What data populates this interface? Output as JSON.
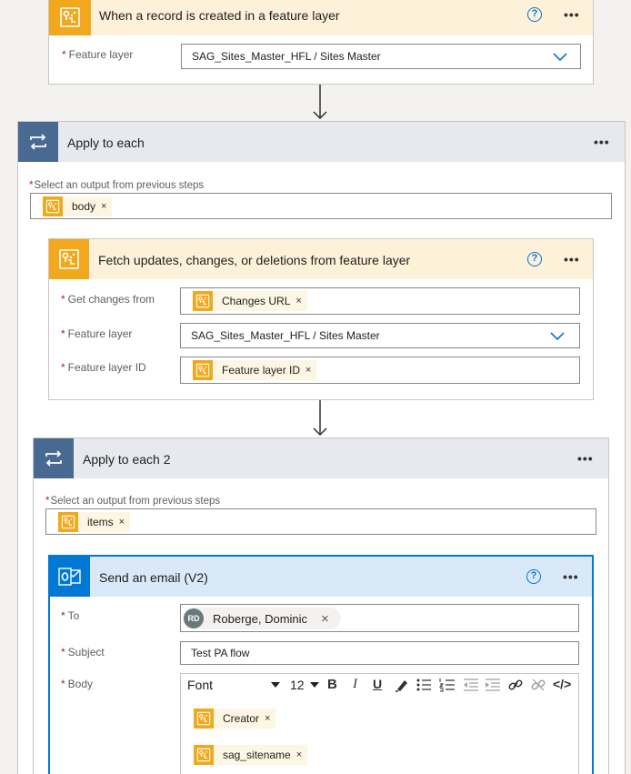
{
  "trigger": {
    "title": "When a record is created in a feature layer",
    "help": "?",
    "more": "•••",
    "feature_layer_label": "Feature layer",
    "feature_layer_value": "SAG_Sites_Master_HFL / Sites Master"
  },
  "loop1": {
    "title": "Apply to each",
    "more": "•••",
    "select_label": "Select an output from previous steps",
    "token": "body"
  },
  "fetch": {
    "title": "Fetch updates, changes, or deletions from feature layer",
    "help": "?",
    "more": "•••",
    "changes_label": "Get changes from",
    "changes_token": "Changes URL",
    "layer_label": "Feature layer",
    "layer_value": "SAG_Sites_Master_HFL / Sites Master",
    "layer_id_label": "Feature layer ID",
    "layer_id_token": "Feature layer ID"
  },
  "loop2": {
    "title": "Apply to each 2",
    "more": "•••",
    "select_label": "Select an output from previous steps",
    "token": "items"
  },
  "email": {
    "title": "Send an email (V2)",
    "help": "?",
    "more": "•••",
    "to_label": "To",
    "to_initials": "RD",
    "to_name": "Roberge, Dominic",
    "subject_label": "Subject",
    "subject_value": "Test PA flow",
    "body_label": "Body",
    "font_label": "Font",
    "font_size": "12",
    "bold": "B",
    "italic": "I",
    "underline": "U",
    "code": "</>",
    "body_tokens": [
      "Creator",
      "sag_sitename"
    ]
  },
  "common": {
    "remove": "×",
    "required": "*"
  },
  "colors": {
    "arcgis_orange": "#f2a81d",
    "arcgis_header": "#fdf1d9",
    "loop_header": "#e7e9ef",
    "loop_icon": "#486991",
    "outlook_blue": "#0078d4",
    "email_header": "#d9e9f8"
  }
}
